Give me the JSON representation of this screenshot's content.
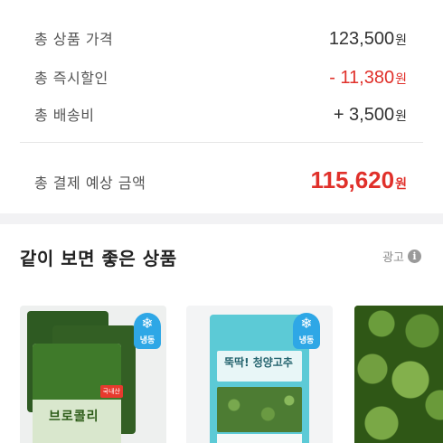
{
  "summary": {
    "product_price": {
      "label": "총 상품 가격",
      "amount": "123,500",
      "unit": "원"
    },
    "instant_discount": {
      "label": "총 즉시할인",
      "amount": "- 11,380",
      "unit": "원"
    },
    "shipping": {
      "label": "총 배송비",
      "amount": "+ 3,500",
      "unit": "원"
    },
    "total": {
      "label": "총 결제 예상 금액",
      "amount": "115,620",
      "unit": "원"
    }
  },
  "recommend": {
    "title": "같이 보면 좋은 상품",
    "ad_label": "광고",
    "info_glyph": "i",
    "products": [
      {
        "frozen_badge": "냉동",
        "name": "브로콜리",
        "tag": "국내산"
      },
      {
        "frozen_badge": "냉동",
        "name": "뚝딱! 청양고추"
      },
      {
        "image": "broccoli-photo"
      }
    ]
  },
  "colors": {
    "accent_red": "#e0302a",
    "frozen_blue": "#2ea7e6"
  },
  "icons": {
    "snowflake": "snowflake-icon",
    "info": "info-icon"
  }
}
